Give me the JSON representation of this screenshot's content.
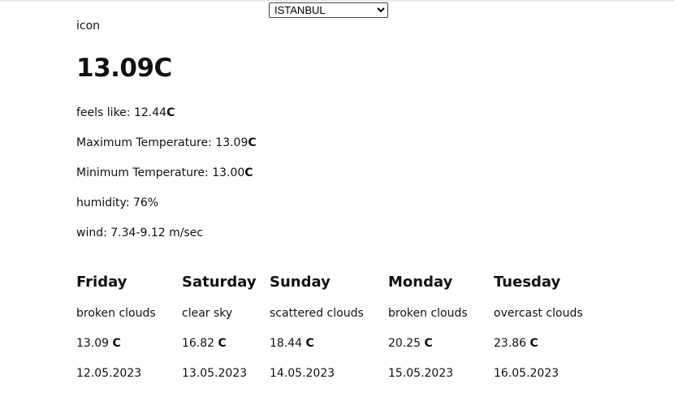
{
  "city_select": {
    "selected": "ISTANBUL",
    "options": [
      "ISTANBUL"
    ]
  },
  "current": {
    "icon_text": "icon",
    "temperature": "13.09C",
    "feels_like_label": "feels like: ",
    "feels_like_value": "12.44",
    "max_label": "Maximum Temperature: ",
    "max_value": "13.09",
    "min_label": "Minimum Temperature: ",
    "min_value": "13.00",
    "humidity": "humidity: 76%",
    "wind": "wind: 7.34-9.12 m/sec",
    "unit": "C"
  },
  "forecast": [
    {
      "day": "Friday",
      "description": "broken clouds",
      "temp": "13.09 ",
      "unit": "C",
      "date": "12.05.2023"
    },
    {
      "day": "Saturday",
      "description": "clear sky",
      "temp": "16.82 ",
      "unit": "C",
      "date": "13.05.2023"
    },
    {
      "day": "Sunday",
      "description": "scattered clouds",
      "temp": "18.44 ",
      "unit": "C",
      "date": "14.05.2023"
    },
    {
      "day": "Monday",
      "description": "broken clouds",
      "temp": "20.25 ",
      "unit": "C",
      "date": "15.05.2023"
    },
    {
      "day": "Tuesday",
      "description": "overcast clouds",
      "temp": "23.86 ",
      "unit": "C",
      "date": "16.05.2023"
    }
  ]
}
